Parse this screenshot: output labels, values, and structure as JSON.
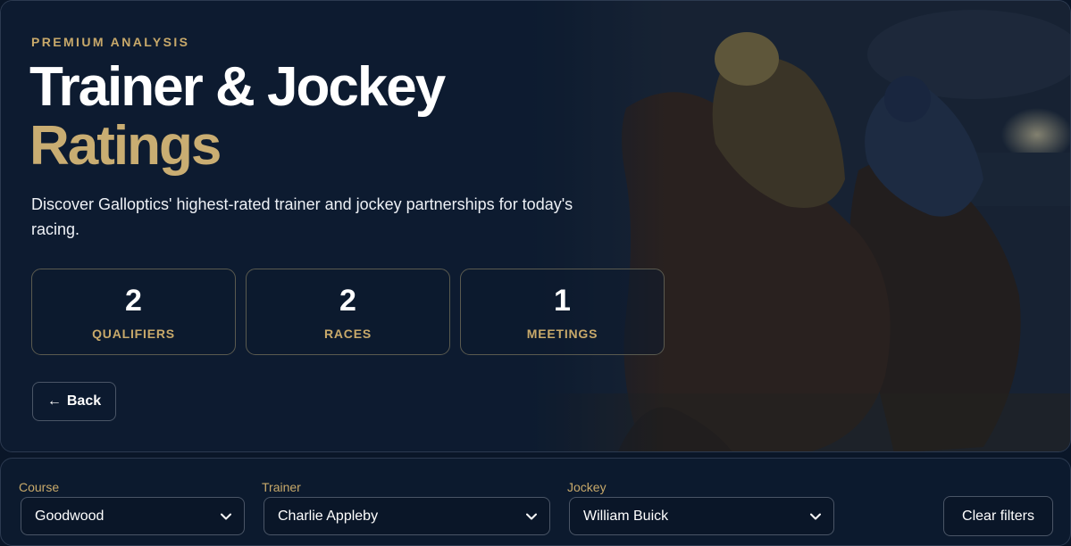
{
  "hero": {
    "eyebrow": "PREMIUM ANALYSIS",
    "title_line1": "Trainer & Jockey",
    "title_line2": "Ratings",
    "description": "Discover Galloptics' highest-rated trainer and jockey partnerships for today's racing.",
    "stats": [
      {
        "value": "2",
        "label": "QUALIFIERS"
      },
      {
        "value": "2",
        "label": "RACES"
      },
      {
        "value": "1",
        "label": "MEETINGS"
      }
    ],
    "back_arrow": "←",
    "back_label": "Back",
    "image_icon": "racing-horses-illustration"
  },
  "filters": {
    "course": {
      "label": "Course",
      "value": "Goodwood"
    },
    "trainer": {
      "label": "Trainer",
      "value": "Charlie Appleby"
    },
    "jockey": {
      "label": "Jockey",
      "value": "William Buick"
    },
    "clear_label": "Clear filters",
    "chevron_icon": "chevron-down-icon"
  },
  "colors": {
    "accent_gold": "#c8a96a",
    "background": "#0a1628",
    "border": "#4a5566"
  }
}
